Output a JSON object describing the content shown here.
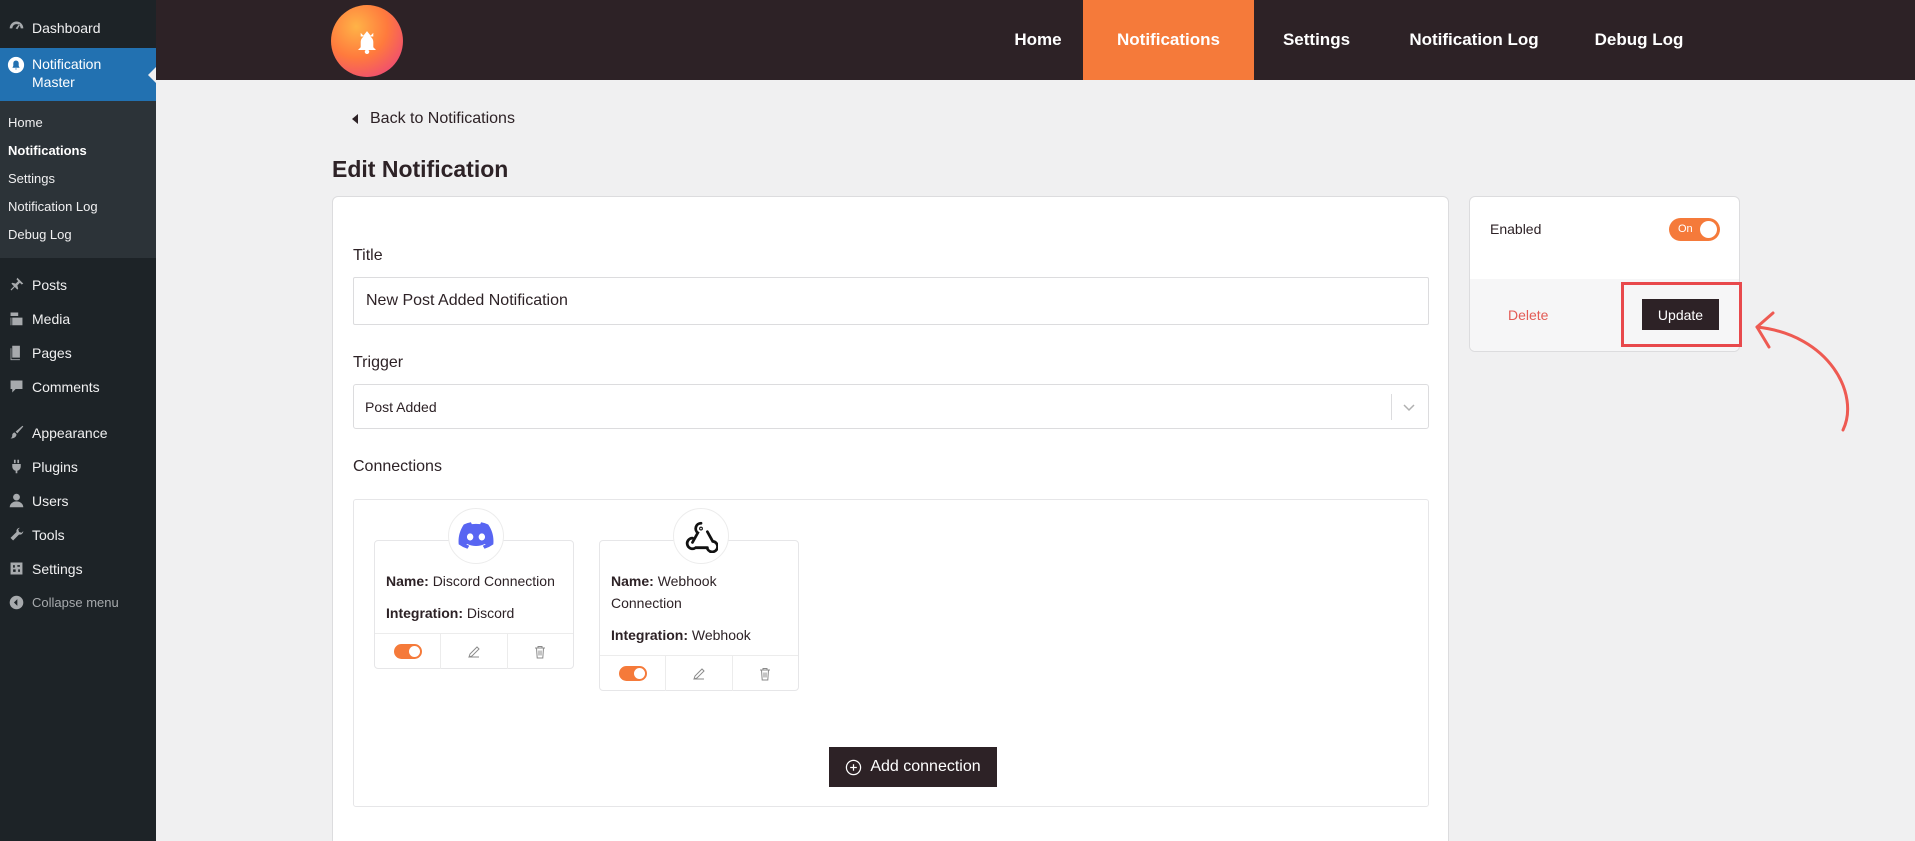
{
  "wp_sidebar": {
    "dashboard": "Dashboard",
    "active_plugin": "Notification Master",
    "submenu": [
      "Home",
      "Notifications",
      "Settings",
      "Notification Log",
      "Debug Log"
    ],
    "menu": [
      "Posts",
      "Media",
      "Pages",
      "Comments",
      "Appearance",
      "Plugins",
      "Users",
      "Tools",
      "Settings"
    ],
    "collapse": "Collapse menu"
  },
  "topnav": {
    "items": [
      "Home",
      "Notifications",
      "Settings",
      "Notification Log",
      "Debug Log"
    ],
    "active": "Notifications",
    "accent_color": "#f57a3a",
    "bar_color": "#2d2226"
  },
  "back_link": "Back to Notifications",
  "page_title": "Edit Notification",
  "form": {
    "title_label": "Title",
    "title_value": "New Post Added Notification",
    "trigger_label": "Trigger",
    "trigger_value": "Post Added",
    "connections_label": "Connections"
  },
  "connections": [
    {
      "icon": "discord-icon",
      "name_label": "Name:",
      "name": "Discord Connection",
      "integration_label": "Integration:",
      "integration": "Discord",
      "enabled": true
    },
    {
      "icon": "webhook-icon",
      "name_label": "Name:",
      "name": "Webhook Connection",
      "integration_label": "Integration:",
      "integration": "Webhook",
      "enabled": true
    }
  ],
  "add_connection": "Add connection",
  "side": {
    "enabled_label": "Enabled",
    "toggle_text": "On",
    "delete": "Delete",
    "update": "Update"
  }
}
